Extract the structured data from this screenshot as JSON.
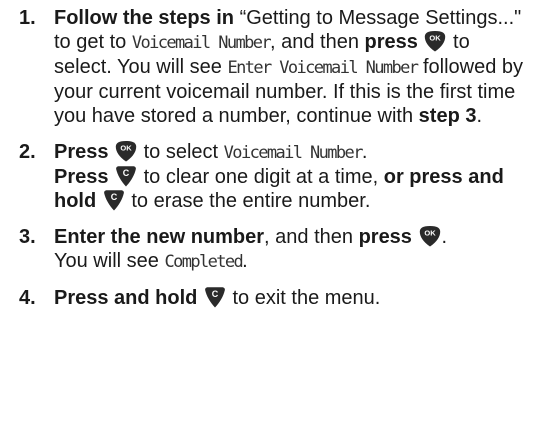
{
  "steps": [
    {
      "num": "1.",
      "a": "Follow the steps in",
      "b": " “Getting to Message Settings...\" to get to ",
      "c": "Voicemail Number",
      "d": ", and then ",
      "e": "press",
      "f": " to select. You will see ",
      "g": "Enter Voicemail Number",
      "h": " followed by your current voicemail number. If this is the first time you have stored a number, continue with ",
      "i": "step 3",
      "j": "."
    },
    {
      "num": "2.",
      "a": "Press",
      "b": " to select ",
      "c": "Voicemail Number",
      "d": ".",
      "e": "Press",
      "f": " to clear one digit at a time, ",
      "g": "or press and hold",
      "h": " to erase the entire number."
    },
    {
      "num": "3.",
      "a": "Enter the new number",
      "b": ", and then ",
      "c": "press",
      "d": ".",
      "e": "You will see ",
      "f": "Completed",
      "g": "."
    },
    {
      "num": "4.",
      "a": "Press and hold",
      "b": " to exit the menu."
    }
  ],
  "keys": {
    "ok": "OK",
    "clear": "C"
  },
  "colors": {
    "key_fill": "#2a2a2a",
    "key_text": "#ffffff",
    "lcd_text": "#333333"
  }
}
